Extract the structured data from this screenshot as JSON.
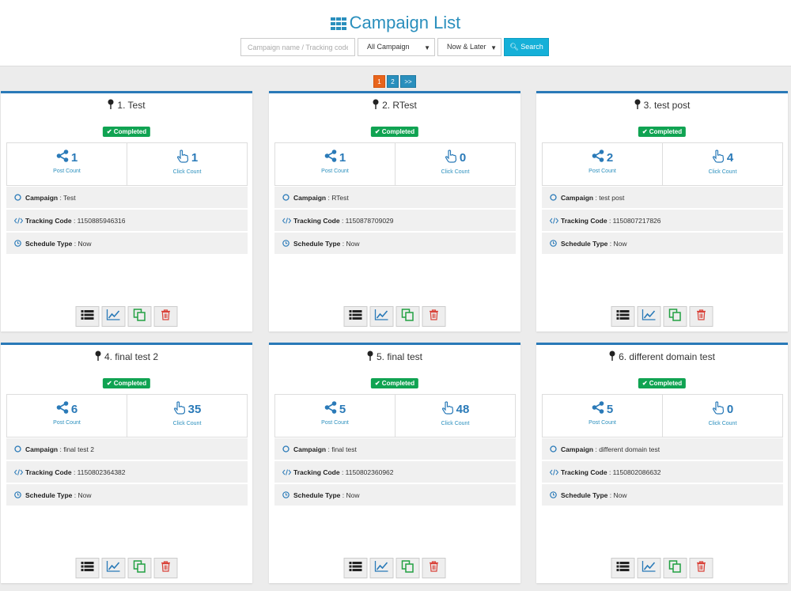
{
  "header": {
    "title": "Campaign List",
    "search_placeholder": "Campaign name / Tracking code",
    "campaign_filter": "All Campaign",
    "time_filter": "Now & Later",
    "search_label": "Search"
  },
  "pagination": [
    "1",
    "2",
    ">>"
  ],
  "labels": {
    "completed": "Completed",
    "post_count": "Post Count",
    "click_count": "Click Count",
    "campaign": "Campaign",
    "tracking": "Tracking Code",
    "schedule": "Schedule Type"
  },
  "cards": [
    {
      "title": "1. Test",
      "posts": "1",
      "clicks": "1",
      "campaign": ": Test",
      "tracking": ": 1150885946316",
      "schedule": ": Now"
    },
    {
      "title": "2. RTest",
      "posts": "1",
      "clicks": "0",
      "campaign": ": RTest",
      "tracking": ": 1150878709029",
      "schedule": ": Now"
    },
    {
      "title": "3. test post",
      "posts": "2",
      "clicks": "4",
      "campaign": ": test post",
      "tracking": ": 1150807217826",
      "schedule": ": Now"
    },
    {
      "title": "4. final test 2",
      "posts": "6",
      "clicks": "35",
      "campaign": ": final test 2",
      "tracking": ": 1150802364382",
      "schedule": ": Now"
    },
    {
      "title": "5. final test",
      "posts": "5",
      "clicks": "48",
      "campaign": ": final test",
      "tracking": ": 1150802360962",
      "schedule": ": Now"
    },
    {
      "title": "6. different domain test",
      "posts": "5",
      "clicks": "0",
      "campaign": ": different domain test",
      "tracking": ": 1150802086632",
      "schedule": ": Now"
    }
  ],
  "colors": {
    "accent": "#2a7ab8",
    "completed": "#10a352",
    "active_page": "#e8641b",
    "search": "#15b0d8",
    "delete": "#d9433a",
    "copy": "#22a042"
  }
}
